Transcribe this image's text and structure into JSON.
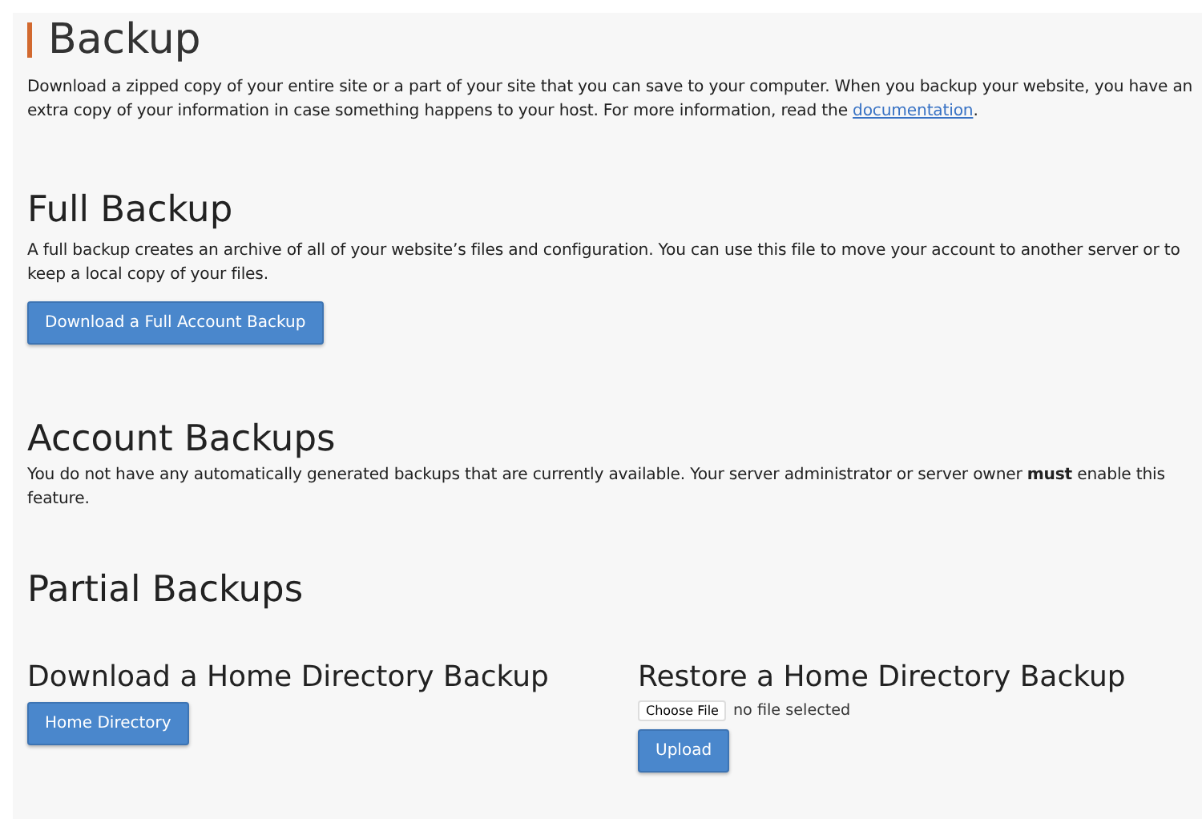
{
  "page_title": "Backup",
  "intro": {
    "text": "Download a zipped copy of your entire site or a part of your site that you can save to your computer. When you backup your website, you have an extra copy of your information in case something happens to your host. For more information, read the ",
    "link": "documentation",
    "after": "."
  },
  "full_backup": {
    "heading": "Full Backup",
    "text": "A full backup creates an archive of all of your website’s files and configuration. You can use this file to move your account to another server or to keep a local copy of your files.",
    "button": "Download a Full Account Backup"
  },
  "account_backups": {
    "heading": "Account Backups",
    "text": "You do not have any automatically generated backups that are currently available. Your server administrator or server owner **must** enable this feature."
  },
  "partial_backups": {
    "heading": "Partial Backups",
    "download": {
      "heading": "Download a Home Directory Backup",
      "button": "Home Directory"
    },
    "restore": {
      "heading": "Restore a Home Directory Backup",
      "file_button": "Choose File",
      "file_status": "no file selected",
      "button": "Upload"
    }
  }
}
